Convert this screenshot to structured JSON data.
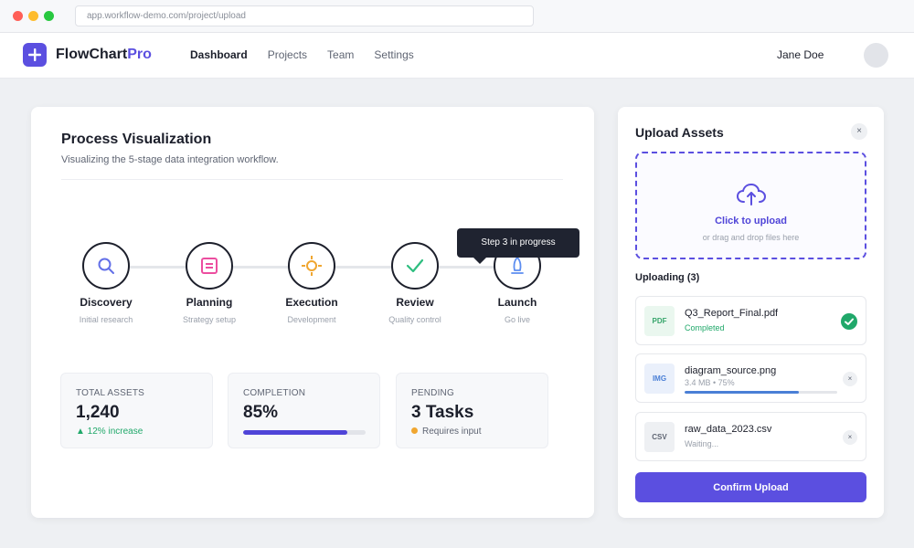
{
  "browser": {
    "url": "app.workflow-demo.com/project/upload"
  },
  "header": {
    "brand_main": "FlowChart",
    "brand_accent": "Pro",
    "nav": [
      {
        "label": "Dashboard"
      },
      {
        "label": "Projects"
      },
      {
        "label": "Team"
      },
      {
        "label": "Settings"
      }
    ],
    "user_name": "Jane Doe"
  },
  "process": {
    "title": "Process Visualization",
    "subtitle": "Visualizing the 5-stage data integration workflow.",
    "steps": [
      {
        "name": "Discovery",
        "desc": "Initial research",
        "icon": "search-icon",
        "color": "#6370e8"
      },
      {
        "name": "Planning",
        "desc": "Strategy setup",
        "icon": "document-list-icon",
        "color": "#ec4ea0"
      },
      {
        "name": "Execution",
        "desc": "Development",
        "icon": "target-icon",
        "color": "#f0a630"
      },
      {
        "name": "Review",
        "desc": "Quality control",
        "icon": "check-icon",
        "color": "#2fbe80"
      },
      {
        "name": "Launch",
        "desc": "Go live",
        "icon": "rocket-icon",
        "color": "#5c8df0"
      }
    ],
    "tooltip": "Step 3 in progress"
  },
  "stats": {
    "total_assets": {
      "label": "TOTAL ASSETS",
      "value": "1,240",
      "note": "▲ 12% increase"
    },
    "completion": {
      "label": "COMPLETION",
      "value": "85%",
      "progress_percent": 85
    },
    "pending": {
      "label": "PENDING",
      "value": "3 Tasks",
      "note": "Requires input"
    }
  },
  "upload": {
    "title": "Upload Assets",
    "close": "×",
    "dropzone_title": "Click to upload",
    "dropzone_sub": "or drag and drop files here",
    "uploading_title": "Uploading (3)",
    "files": [
      {
        "type": "PDF",
        "name": "Q3_Report_Final.pdf",
        "status": "Completed"
      },
      {
        "type": "IMG",
        "name": "diagram_source.png",
        "status": "3.4 MB • 75%",
        "progress_percent": 75
      },
      {
        "type": "CSV",
        "name": "raw_data_2023.csv",
        "status": "Waiting..."
      }
    ],
    "file_close": "×",
    "confirm_label": "Confirm Upload"
  },
  "colors": {
    "brand": "#5b4fe0",
    "success": "#20a86a",
    "info": "#4a7fd6"
  }
}
